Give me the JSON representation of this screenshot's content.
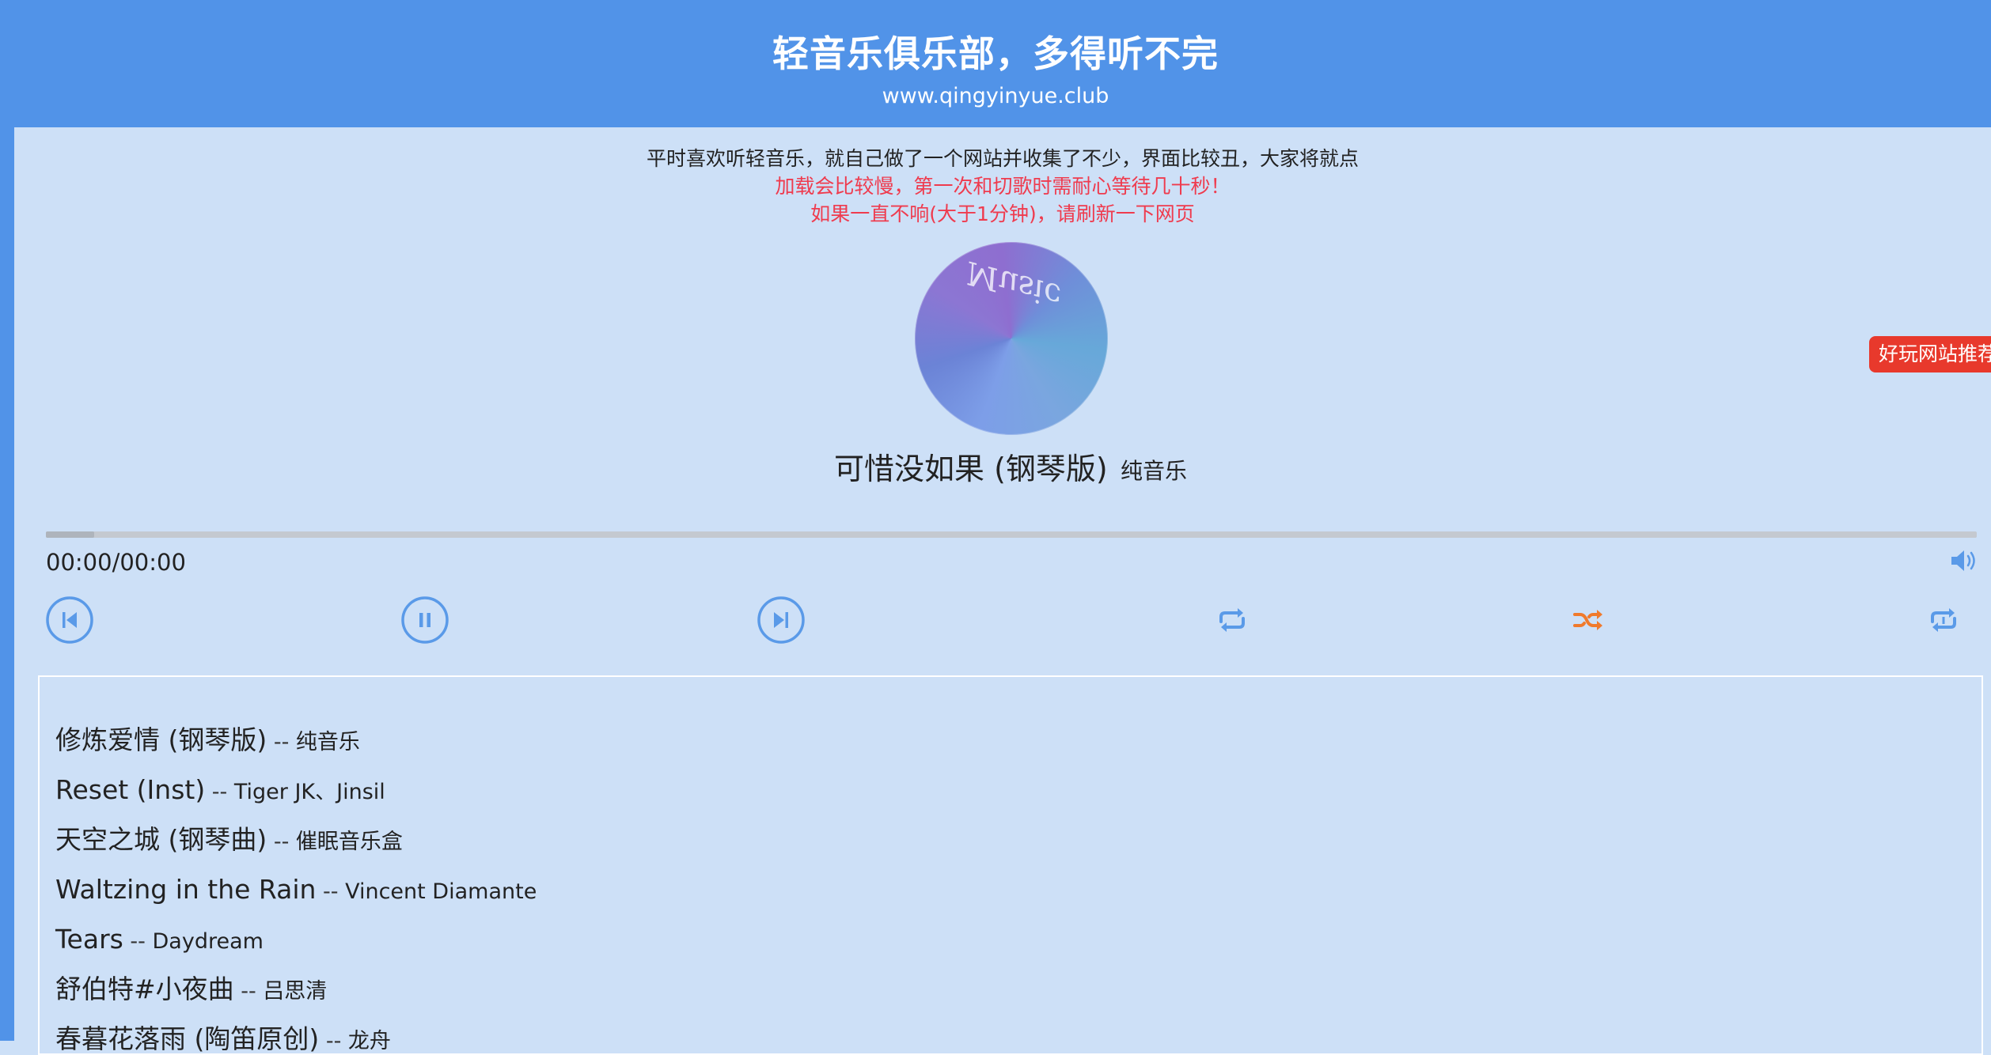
{
  "header": {
    "title": "轻音乐俱乐部，多得听不完",
    "subtitle": "www.qingyinyue.club"
  },
  "notice": {
    "line1": "平时喜欢听轻音乐，就自己做了一个网站并收集了不少，界面比较丑，大家将就点",
    "line2": "加载会比较慢，第一次和切歌时需耐心等待几十秒！",
    "line3": "如果一直不响(大于1分钟)，请刷新一下网页"
  },
  "album": {
    "art_text": "Music"
  },
  "now_playing": {
    "title": "可惜没如果 (钢琴版)",
    "artist": "纯音乐"
  },
  "side_badge": {
    "label": "好玩网站推荐"
  },
  "player": {
    "time": "00:00/00:00",
    "progress_fraction": 0.025,
    "accent_color": "#5a9ae8",
    "shuffle_color": "#f07a2c",
    "controls": [
      {
        "name": "prev-button",
        "icon": "skip-back-icon"
      },
      {
        "name": "pause-button",
        "icon": "pause-icon"
      },
      {
        "name": "next-button",
        "icon": "skip-forward-icon"
      },
      {
        "name": "repeat-button",
        "icon": "repeat-icon"
      },
      {
        "name": "shuffle-button",
        "icon": "shuffle-icon"
      },
      {
        "name": "repeat-one-button",
        "icon": "repeat-one-icon"
      }
    ]
  },
  "playlist": {
    "separator": " -- ",
    "items": [
      {
        "title": "修炼爱情 (钢琴版)",
        "artist": "纯音乐"
      },
      {
        "title": "Reset (Inst)",
        "artist": "Tiger JK、Jinsil"
      },
      {
        "title": "天空之城 (钢琴曲)",
        "artist": "催眠音乐盒"
      },
      {
        "title": "Waltzing in the Rain",
        "artist": "Vincent Diamante"
      },
      {
        "title": "Tears",
        "artist": "Daydream"
      },
      {
        "title": "舒伯特#小夜曲",
        "artist": "吕思清"
      },
      {
        "title": "春暮花落雨 (陶笛原创)",
        "artist": "龙舟"
      }
    ]
  }
}
